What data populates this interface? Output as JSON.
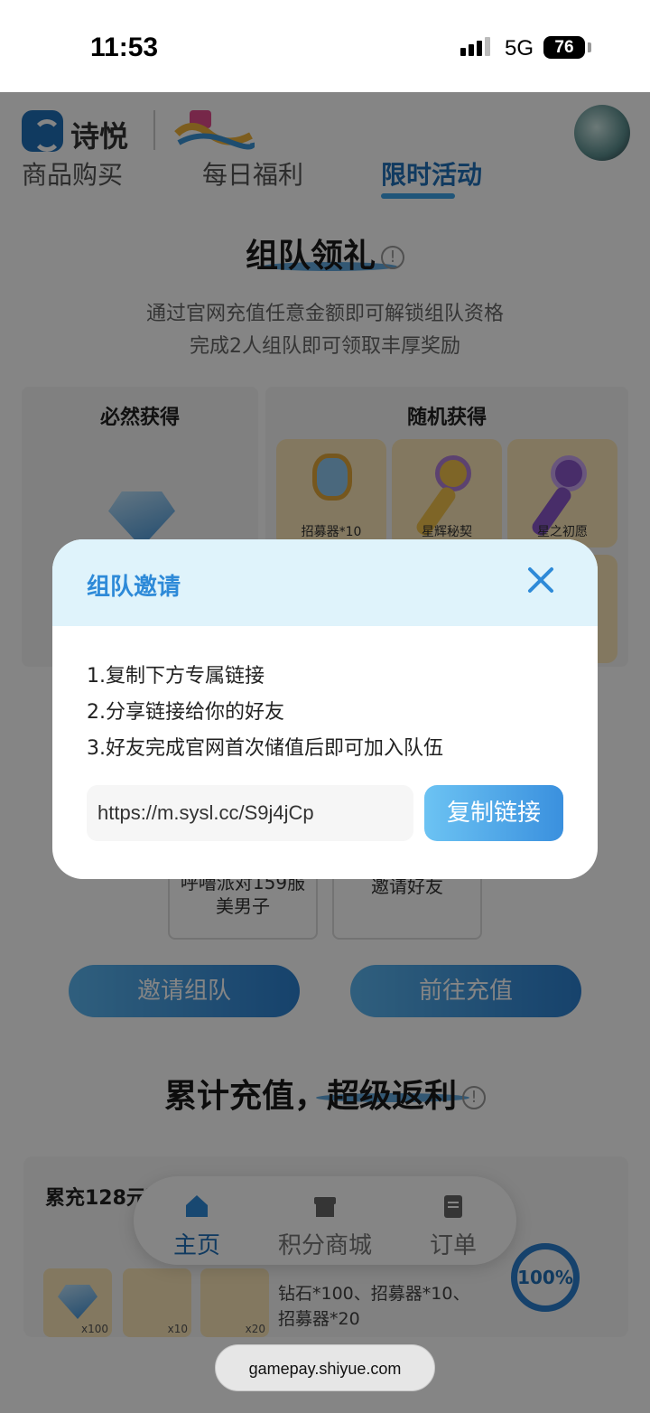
{
  "status_bar": {
    "time": "11:53",
    "network": "5G",
    "battery": "76"
  },
  "header": {
    "brand": "诗悦"
  },
  "tabs": [
    "商品购买",
    "每日福利",
    "限时活动"
  ],
  "team_section": {
    "title": "组队领礼",
    "desc_line1": "通过官网充值任意金额即可解锁组队资格",
    "desc_line2": "完成2人组队即可领取丰厚奖励",
    "guaranteed_title": "必然获得",
    "random_title": "随机获得",
    "random_items": [
      "招募器*10",
      "星辉秘契",
      "星之初愿"
    ],
    "members": [
      {
        "label": "呼噜派对159服\n美男子"
      },
      {
        "label": "邀请好友"
      }
    ],
    "invite_button": "邀请组队",
    "recharge_button": "前往充值"
  },
  "accum_section": {
    "title": "累计充值，超级返利",
    "tier_title": "累充128元可",
    "item_badges": [
      "x100",
      "x10",
      "x20"
    ],
    "reward_desc": "钻石*100、招募器*10、招募器*20",
    "progress": "100%"
  },
  "bottom_nav": {
    "items": [
      {
        "label": "主页",
        "icon": "home-icon",
        "active": true
      },
      {
        "label": "积分商城",
        "icon": "store-icon",
        "active": false
      },
      {
        "label": "订单",
        "icon": "clipboard-icon",
        "active": false
      }
    ]
  },
  "modal": {
    "title": "组队邀请",
    "steps": [
      "1.复制下方专属链接",
      "2.分享链接给你的好友",
      "3.好友完成官网首次储值后即可加入队伍"
    ],
    "link": "https://m.sysl.cc/S9j4jCp",
    "copy_button": "复制链接"
  },
  "browser": {
    "domain": "gamepay.shiyue.com"
  },
  "colors": {
    "accent": "#2e8ad8",
    "overlay": "rgba(0,0,0,0.48)"
  }
}
